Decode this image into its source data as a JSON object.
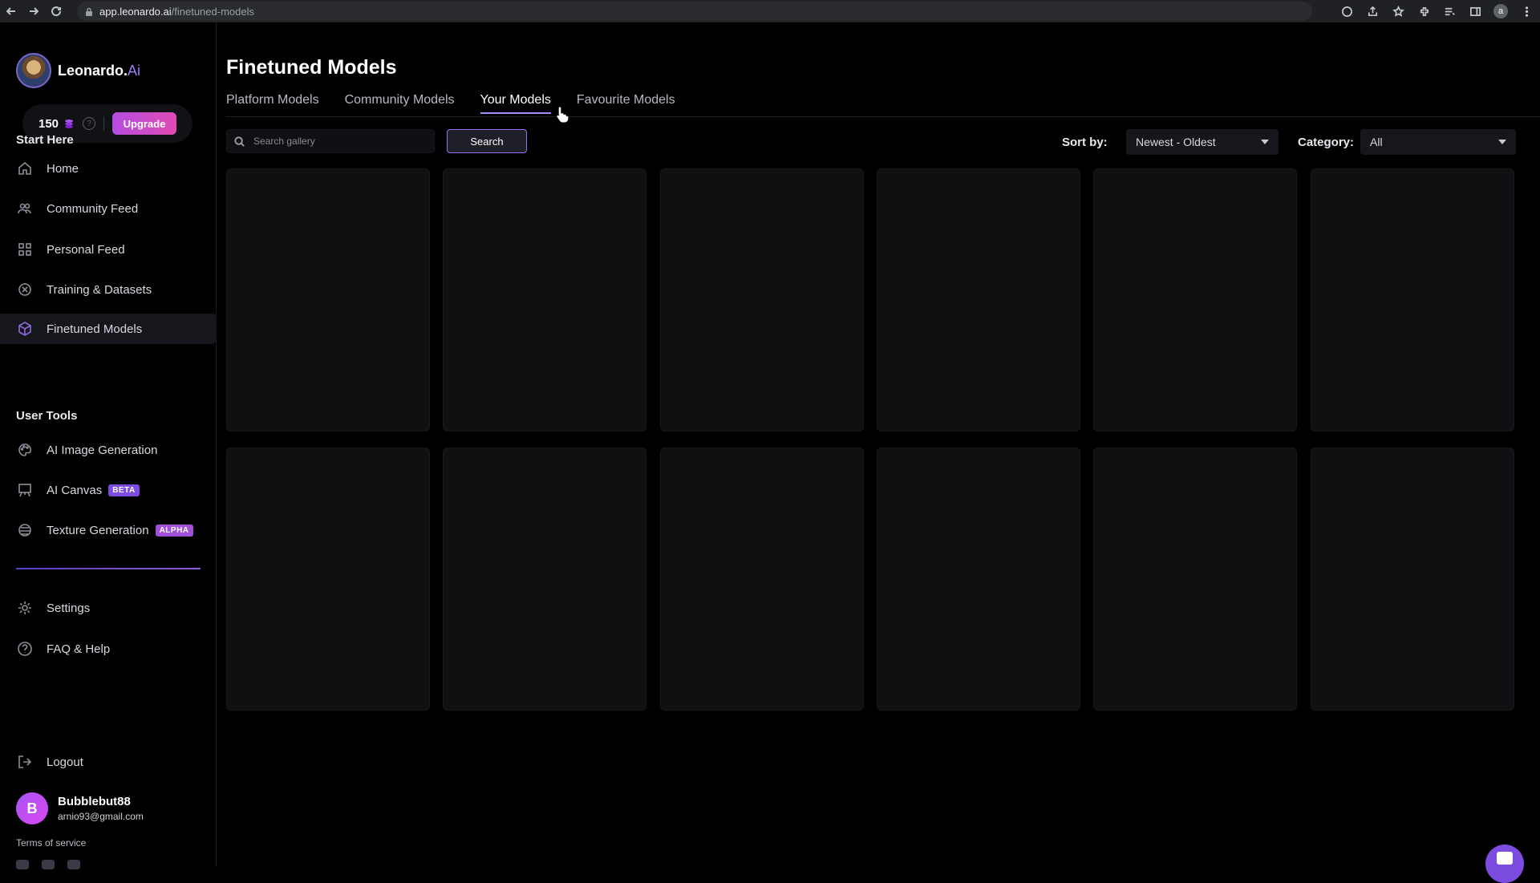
{
  "browser": {
    "url_host": "app.leonardo.ai",
    "url_path": "/finetuned-models",
    "profile_initial": "a"
  },
  "brand": {
    "name": "Leonardo.",
    "name_suffix": "Ai"
  },
  "credits": {
    "count": "150",
    "help": "?",
    "upgrade_label": "Upgrade"
  },
  "sidebar": {
    "section_start": "Start Here",
    "section_tools": "User Tools",
    "items": [
      {
        "label": "Home",
        "icon": "home-icon"
      },
      {
        "label": "Community Feed",
        "icon": "people-icon"
      },
      {
        "label": "Personal Feed",
        "icon": "grid-icon"
      },
      {
        "label": "Training & Datasets",
        "icon": "training-icon"
      },
      {
        "label": "Finetuned Models",
        "icon": "cube-icon",
        "active": true
      },
      {
        "label": "AI Image Generation",
        "icon": "palette-icon"
      },
      {
        "label": "AI Canvas",
        "icon": "easel-icon",
        "badge": "BETA"
      },
      {
        "label": "Texture Generation",
        "icon": "texture-icon",
        "badge": "ALPHA"
      },
      {
        "label": "Settings",
        "icon": "gear-icon"
      },
      {
        "label": "FAQ & Help",
        "icon": "question-icon"
      },
      {
        "label": "Logout",
        "icon": "logout-icon"
      }
    ]
  },
  "user": {
    "initial": "B",
    "name": "Bubblebut88",
    "email": "arnio93@gmail.com",
    "terms": "Terms of service"
  },
  "main": {
    "title": "Finetuned Models",
    "tabs": [
      {
        "label": "Platform Models"
      },
      {
        "label": "Community Models"
      },
      {
        "label": "Your Models",
        "active": true
      },
      {
        "label": "Favourite Models"
      }
    ],
    "search_placeholder": "Search gallery",
    "search_button": "Search",
    "sort_label": "Sort by:",
    "sort_value": "Newest - Oldest",
    "category_label": "Category:",
    "category_value": "All"
  },
  "colors": {
    "accent": "#9b6ef0",
    "upgrade_gradient_start": "#b54de0",
    "upgrade_gradient_end": "#e14bb4",
    "background": "#000000",
    "card": "#101013"
  }
}
